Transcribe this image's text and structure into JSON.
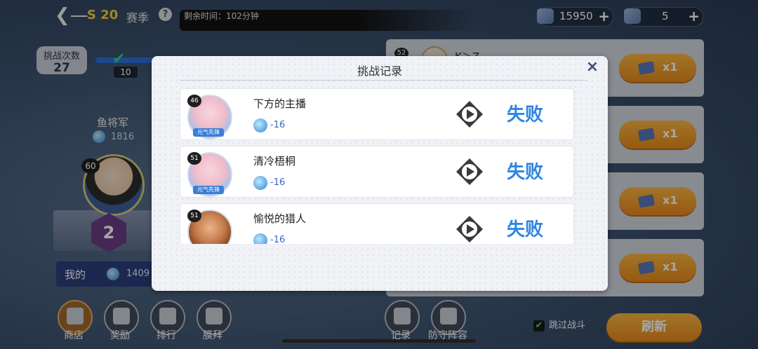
{
  "header": {
    "season": "S 20",
    "season_label": "赛季",
    "help": "?",
    "timer": "剩余时间：102分钟",
    "coins": "15950",
    "tickets": "5",
    "plus": "+"
  },
  "left": {
    "challenge_label": "挑战次数",
    "challenge_count": "27",
    "node_value": "10",
    "opponent_name": "鱼将军",
    "opponent_points": "1816",
    "opponent_level": "60",
    "rank": "2",
    "mine_label": "我的",
    "mine_points": "1409"
  },
  "right": {
    "top_opponent_level": "52",
    "top_opponent_name": "K＞Z",
    "buttons": [
      "x1",
      "x1",
      "x1",
      "x1"
    ]
  },
  "bottom": {
    "nav": [
      "商店",
      "奖励",
      "排行",
      "膜拜",
      "记录",
      "防守阵容"
    ],
    "skip_label": "跳过战斗",
    "refresh": "刷新"
  },
  "modal": {
    "title": "挑战记录",
    "close": "×",
    "records": [
      {
        "level": "46",
        "name": "下方的主播",
        "points": "-16",
        "result": "失败",
        "tag": "元气先锋"
      },
      {
        "level": "51",
        "name": "清冷梧桐",
        "points": "-16",
        "result": "失败",
        "tag": "元气先锋"
      },
      {
        "level": "51",
        "name": "愉悦的猎人",
        "points": "-16",
        "result": "失败",
        "tag": ""
      }
    ]
  },
  "colors": {
    "accent_orange": "#f0a030",
    "fail_blue": "#2f86e0",
    "season_yellow": "#f6d23a"
  }
}
